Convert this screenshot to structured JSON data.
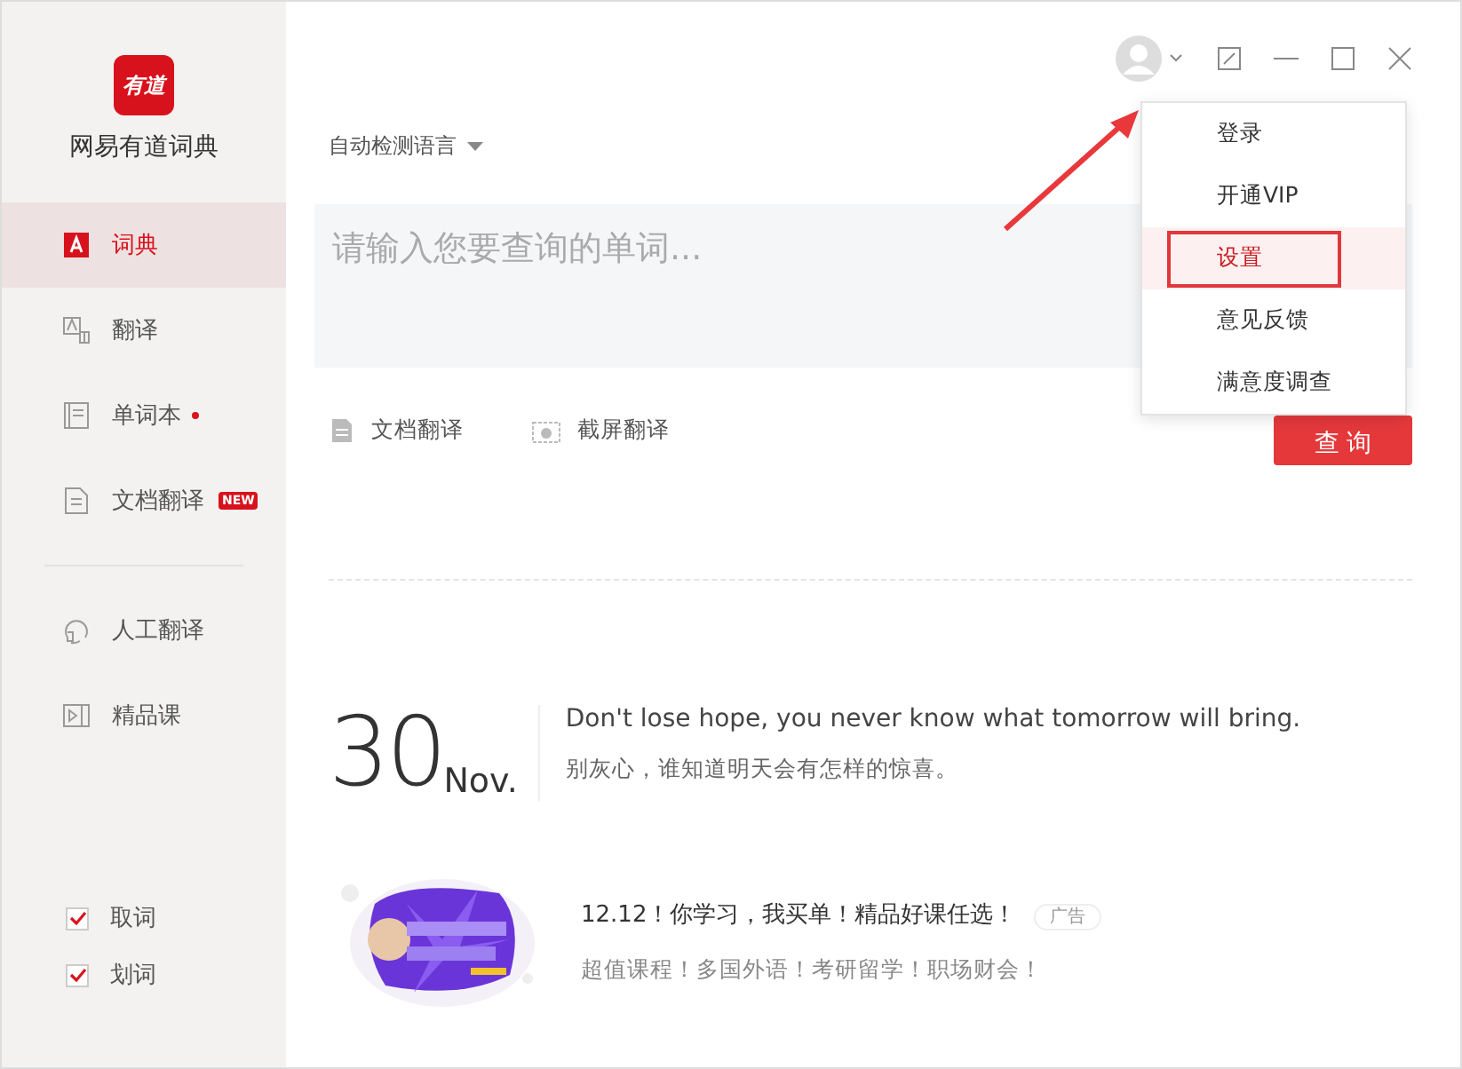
{
  "app": {
    "logo_text": "有道",
    "name": "网易有道词典"
  },
  "sidebar": {
    "items": [
      {
        "kind": "dict",
        "label": "词典",
        "selected": true
      },
      {
        "kind": "translate",
        "label": "翻译",
        "selected": false
      },
      {
        "kind": "wordbook",
        "label": "单词本",
        "selected": false,
        "dot": true
      },
      {
        "kind": "doc",
        "label": "文档翻译",
        "selected": false,
        "badge": "NEW"
      }
    ],
    "more_items": [
      {
        "kind": "human",
        "label": "人工翻译",
        "selected": false
      },
      {
        "kind": "course",
        "label": "精品课",
        "selected": false
      }
    ],
    "options": [
      {
        "label": "取词",
        "checked": true
      },
      {
        "label": "划词",
        "checked": true
      }
    ]
  },
  "language_select": "自动检测语言",
  "search": {
    "placeholder": "请输入您要查询的单词..."
  },
  "tools": [
    "文档翻译",
    "截屏翻译"
  ],
  "search_button": "查 询",
  "user_menu": [
    {
      "label": "登录",
      "selected": false
    },
    {
      "label": "开通VIP",
      "selected": false
    },
    {
      "label": "设置",
      "selected": true
    },
    {
      "label": "意见反馈",
      "selected": false
    },
    {
      "label": "满意度调查",
      "selected": false
    }
  ],
  "daily": {
    "day": "30",
    "month": "Nov.",
    "english": "Don't lose hope, you never know what tomorrow will bring.",
    "chinese": "别灰心，谁知道明天会有怎样的惊喜。"
  },
  "ad": {
    "title": "12.12！你学习，我买单！精品好课任选！",
    "tag": "广告",
    "subtitle": "超值课程！多国外语！考研留学！职场财会！"
  }
}
